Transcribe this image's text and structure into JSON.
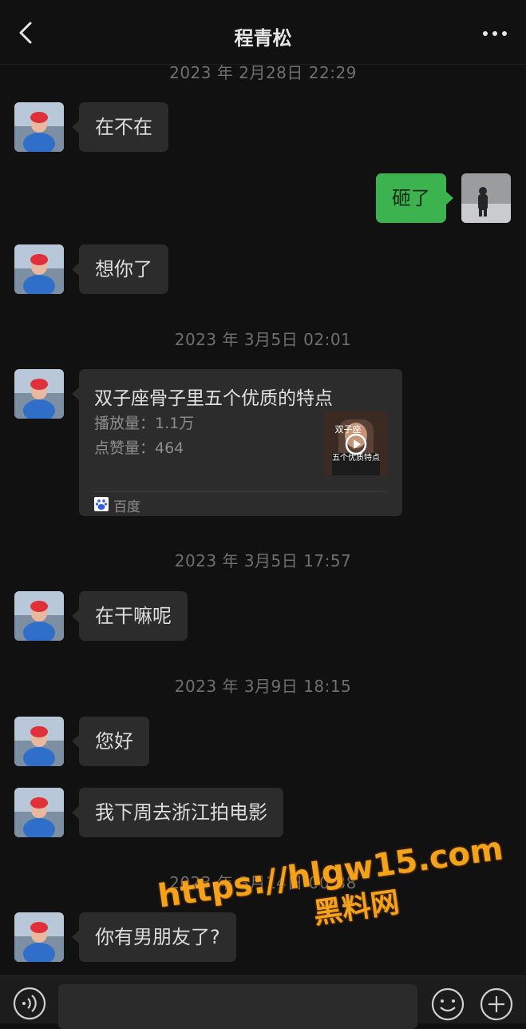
{
  "header": {
    "title": "程青松",
    "back_icon": "chevron-left-icon",
    "more_icon": "more-dots-icon"
  },
  "messages": [
    {
      "type": "time",
      "text": "2023 年 2月28日 22:29"
    },
    {
      "type": "incoming",
      "text": "在不在"
    },
    {
      "type": "outgoing",
      "text": "砸了"
    },
    {
      "type": "incoming",
      "text": "想你了"
    },
    {
      "type": "time",
      "text": "2023 年 3月5日 02:01"
    },
    {
      "type": "incoming_card",
      "card": {
        "title": "双子座骨子里五个优质的特点",
        "plays": "播放量：1.1万",
        "likes": "点赞量：464",
        "source": "百度",
        "thumb_text_top": "双子座",
        "thumb_text_bottom": "五个优质特点"
      }
    },
    {
      "type": "time",
      "text": "2023 年 3月5日 17:57"
    },
    {
      "type": "incoming",
      "text": "在干嘛呢"
    },
    {
      "type": "time",
      "text": "2023 年 3月9日 18:15"
    },
    {
      "type": "incoming",
      "text": "您好"
    },
    {
      "type": "incoming",
      "text": "我下周去浙江拍电影"
    },
    {
      "type": "time",
      "text": "2023 年 3月14日 00:38"
    },
    {
      "type": "incoming",
      "text": "你有男朋友了?"
    }
  ],
  "bottom_bar": {
    "voice_icon": "voice-icon",
    "emoji_icon": "emoji-icon",
    "plus_icon": "plus-icon",
    "input_value": ""
  },
  "watermark": {
    "line1": "https://hlgw15.com",
    "line2": "黑料网"
  },
  "colors": {
    "background": "#111111",
    "bubble": "#2c2c2c",
    "bubble_mine": "#3cb34f",
    "watermark": "#f3a21b"
  }
}
